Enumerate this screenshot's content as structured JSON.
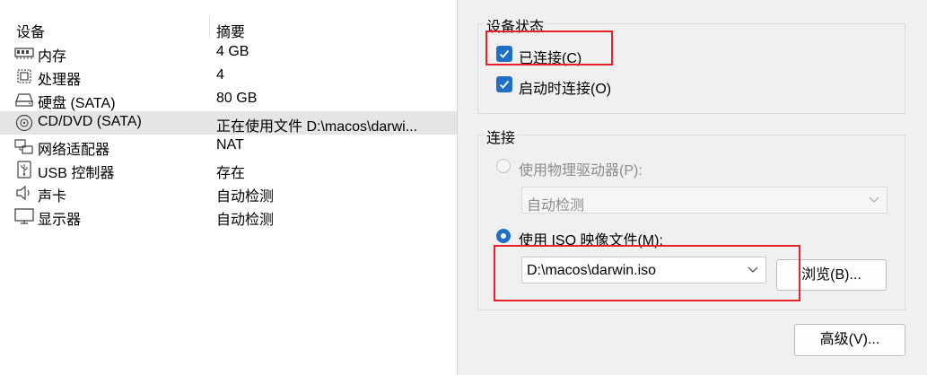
{
  "list": {
    "header_device": "设备",
    "header_summary": "摘要",
    "rows": [
      {
        "name": "内存",
        "summary": "4 GB",
        "icon": "memory-icon"
      },
      {
        "name": "处理器",
        "summary": "4",
        "icon": "cpu-icon"
      },
      {
        "name": "硬盘 (SATA)",
        "summary": "80 GB",
        "icon": "hard-disk-icon"
      },
      {
        "name": "CD/DVD (SATA)",
        "summary": "正在使用文件 D:\\macos\\darwi...",
        "icon": "cd-dvd-icon",
        "selected": true
      },
      {
        "name": "网络适配器",
        "summary": "NAT",
        "icon": "network-adapter-icon"
      },
      {
        "name": "USB 控制器",
        "summary": "存在",
        "icon": "usb-icon"
      },
      {
        "name": "声卡",
        "summary": "自动检测",
        "icon": "speaker-icon"
      },
      {
        "name": "显示器",
        "summary": "自动检测",
        "icon": "monitor-icon"
      }
    ]
  },
  "device_status": {
    "title": "设备状态",
    "connected_label": "已连接(C)",
    "connected_checked": true,
    "connect_on_power_label": "启动时连接(O)",
    "connect_on_power_checked": true
  },
  "connection": {
    "title": "连接",
    "physical_label": "使用物理驱动器(P):",
    "physical_value": "自动检测",
    "iso_label": "使用 ISO 映像文件(M):",
    "iso_value": "D:\\macos\\darwin.iso",
    "browse_label": "浏览(B)...",
    "selected_option": "iso"
  },
  "advanced_label": "高级(V)...",
  "colors": {
    "accent": "#1f6fc5",
    "highlight": "#e8222b",
    "selection": "#e5e5e5"
  }
}
